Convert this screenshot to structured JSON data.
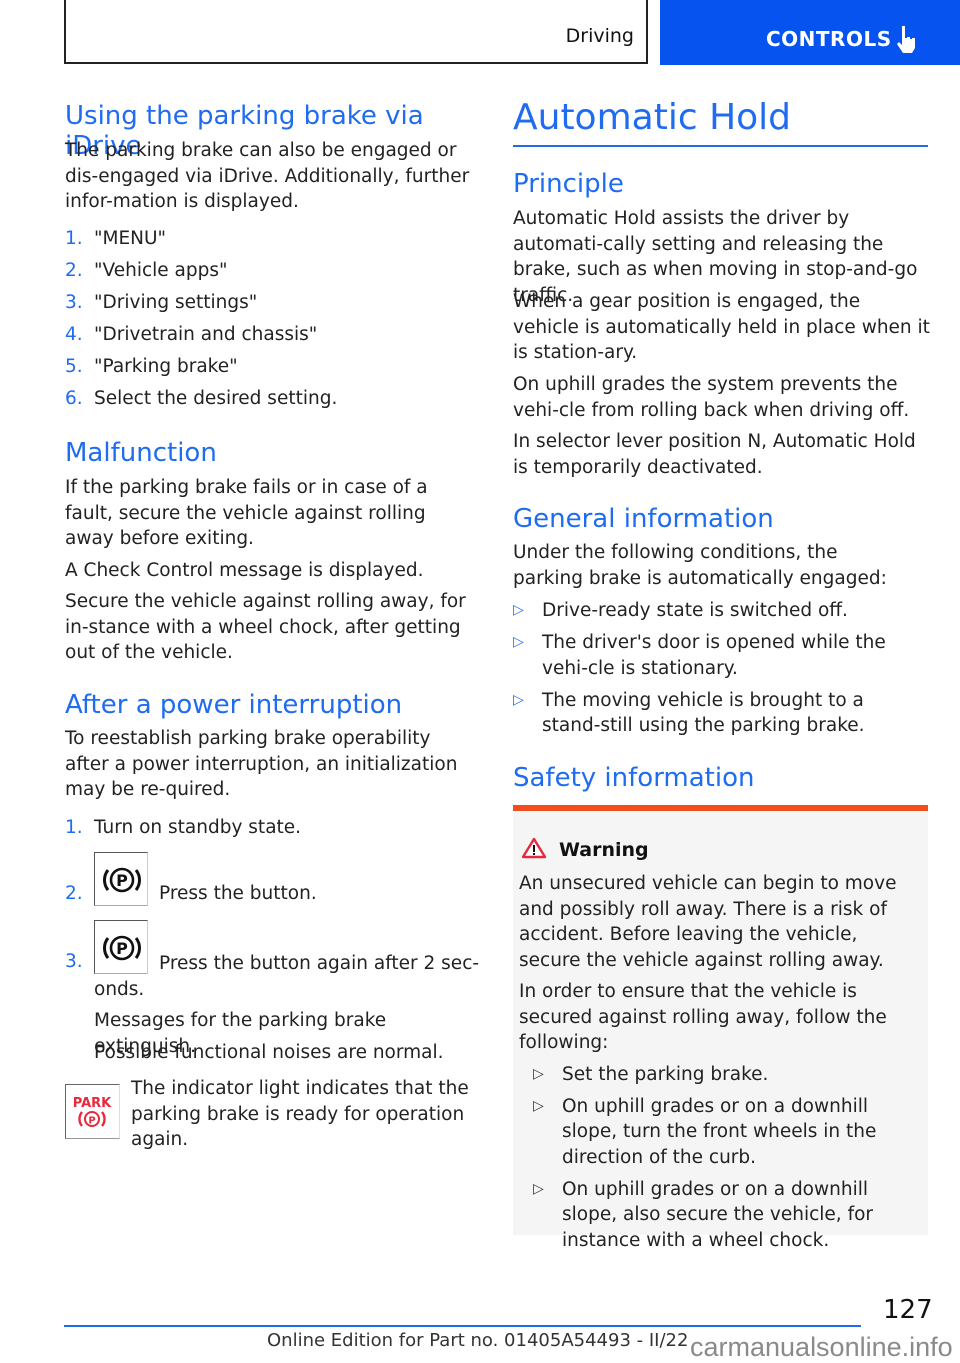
{
  "header": {
    "section": "Driving",
    "chapter": "CONTROLS",
    "chapter_icon": "hand-pointer-icon",
    "accent_color": "#0653f0"
  },
  "left": {
    "idrive": {
      "title": "Using the parking brake via iDrive",
      "intro": "The parking brake can also be engaged or dis-engaged via iDrive. Additionally, further infor-mation is displayed.",
      "steps": [
        {
          "num": "1.",
          "text": "\"MENU\""
        },
        {
          "num": "2.",
          "text": "\"Vehicle apps\""
        },
        {
          "num": "3.",
          "text": "\"Driving settings\""
        },
        {
          "num": "4.",
          "text": "\"Drivetrain and chassis\""
        },
        {
          "num": "5.",
          "text": "\"Parking brake\""
        },
        {
          "num": "6.",
          "text": "Select the desired setting."
        }
      ]
    },
    "malfunction": {
      "title": "Malfunction",
      "p1": "If the parking brake fails or in case of a fault, secure the vehicle against rolling away before exiting.",
      "p2": "A Check Control message is displayed.",
      "p3": "Secure the vehicle against rolling away, for in-stance with a wheel chock, after getting out of the vehicle."
    },
    "power": {
      "title": "After a power interruption",
      "intro": "To reestablish parking brake operability after a power interruption, an initialization may be re-quired.",
      "steps": [
        {
          "num": "1.",
          "text": "Turn on standby state."
        },
        {
          "num": "2.",
          "text": "Press the button.",
          "icon": "parking-brake-button-icon"
        },
        {
          "num": "3.",
          "text": "Press the button again after 2 sec-onds.",
          "icon": "parking-brake-button-icon"
        }
      ],
      "after1": "Messages for the parking brake extinguish.",
      "after2": "Possible functional noises are normal.",
      "indicator_label": "PARK",
      "indicator_text": "The indicator light indicates that the parking brake is ready for operation again.",
      "indicator_color": "#e8283c"
    }
  },
  "right": {
    "title": "Automatic Hold",
    "principle": {
      "title": "Principle",
      "p1": "Automatic Hold assists the driver by automati-cally setting and releasing the brake, such as when moving in stop-and-go traffic.",
      "p2": "When a gear position is engaged, the vehicle is automatically held in place when it is station-ary.",
      "p3": "On uphill grades the system prevents the vehi-cle from rolling back when driving off.",
      "p4": "In selector lever position N, Automatic Hold is temporarily deactivated."
    },
    "general": {
      "title": "General information",
      "intro": "Under the following conditions, the parking brake is automatically engaged:",
      "bullets": [
        "Drive-ready state is switched off.",
        "The driver's door is opened while the vehi-cle is stationary.",
        "The moving vehicle is brought to a stand-still using the parking brake."
      ]
    },
    "safety": {
      "title": "Safety information",
      "warning_label": "Warning",
      "warning_color": "#f24d1c",
      "p1": "An unsecured vehicle can begin to move and possibly roll away. There is a risk of accident. Before leaving the vehicle, secure the vehicle against rolling away.",
      "p2": "In order to ensure that the vehicle is secured against rolling away, follow the following:",
      "bullets": [
        "Set the parking brake.",
        "On uphill grades or on a downhill slope, turn the front wheels in the direction of the curb.",
        "On uphill grades or on a downhill slope, also secure the vehicle, for instance with a wheel chock."
      ]
    }
  },
  "footer": {
    "page_number": "127",
    "edition": "Online Edition for Part no. 01405A54493 - II/22",
    "watermark": "carmanualsonline.info"
  }
}
